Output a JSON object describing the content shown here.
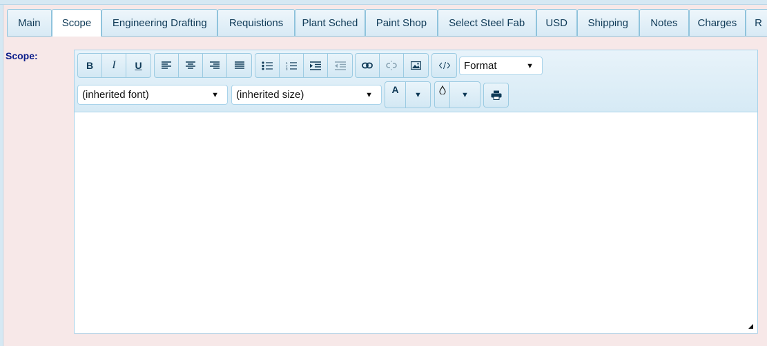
{
  "tabs": [
    {
      "label": "Main",
      "active": false
    },
    {
      "label": "Scope",
      "active": true
    },
    {
      "label": "Engineering Drafting",
      "active": false
    },
    {
      "label": "Requistions",
      "active": false
    },
    {
      "label": "Plant Sched",
      "active": false
    },
    {
      "label": "Paint Shop",
      "active": false
    },
    {
      "label": "Select Steel Fab",
      "active": false
    },
    {
      "label": "USD",
      "active": false
    },
    {
      "label": "Shipping",
      "active": false
    },
    {
      "label": "Notes",
      "active": false
    },
    {
      "label": "Charges",
      "active": false
    },
    {
      "label": "R",
      "active": false
    }
  ],
  "field": {
    "label": "Scope:",
    "value": ""
  },
  "toolbar": {
    "bold": "B",
    "italic": "I",
    "underline": "U",
    "font_color": "A",
    "format_label": "Format",
    "font_label": "(inherited font)",
    "size_label": "(inherited size)"
  },
  "colors": {
    "tab_border": "#8fc3dc",
    "label": "#0a1c8a",
    "background": "#f7e8e8"
  }
}
